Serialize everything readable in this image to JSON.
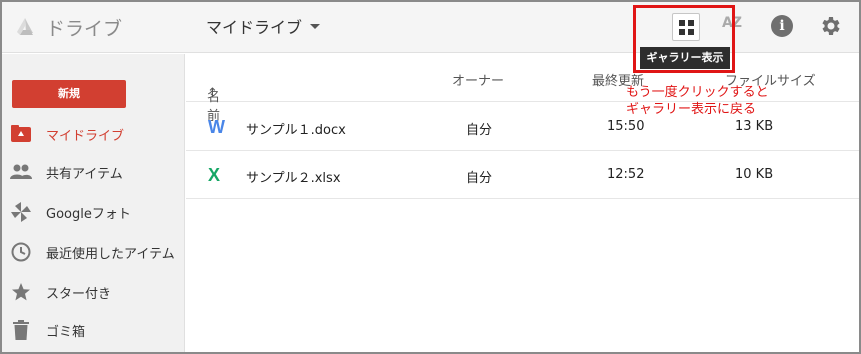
{
  "header": {
    "app_title": "ドライブ",
    "drive_selector": "マイドライブ",
    "gallery_tooltip": "ギャラリー表示",
    "sort_label": "AZ",
    "info_label": "i",
    "icons": [
      "drive-logo-icon",
      "grid-view-icon",
      "sort-az-icon",
      "info-icon",
      "settings-gear-icon"
    ]
  },
  "sidebar": {
    "new_label": "新規",
    "items": [
      {
        "label": "マイドライブ",
        "icon": "my-drive-icon",
        "active": true
      },
      {
        "label": "共有アイテム",
        "icon": "shared-people-icon",
        "active": false
      },
      {
        "label": "Googleフォト",
        "icon": "google-photos-icon",
        "active": false
      },
      {
        "label": "最近使用したアイテム",
        "icon": "clock-icon",
        "active": false
      },
      {
        "label": "スター付き",
        "icon": "star-icon",
        "active": false
      },
      {
        "label": "ゴミ箱",
        "icon": "trash-icon",
        "active": false
      }
    ]
  },
  "list": {
    "columns": {
      "name": "名前",
      "sort_arrow": "↑",
      "owner": "オーナー",
      "modified": "最終更新",
      "size": "ファイルサイズ"
    },
    "rows": [
      {
        "type_letter": "W",
        "type_color": "#4a86e8",
        "name": "サンプル１.docx",
        "owner": "自分",
        "modified": "15:50",
        "size": "13 KB"
      },
      {
        "type_letter": "X",
        "type_color": "#16a765",
        "name": "サンプル２.xlsx",
        "owner": "自分",
        "modified": "12:52",
        "size": "10 KB"
      }
    ]
  },
  "annotation": {
    "line1": "もう一度クリックすると",
    "line2": "ギャラリー表示に戻る"
  },
  "colors": {
    "accent_red": "#d23f31",
    "highlight_red": "#e01515"
  }
}
